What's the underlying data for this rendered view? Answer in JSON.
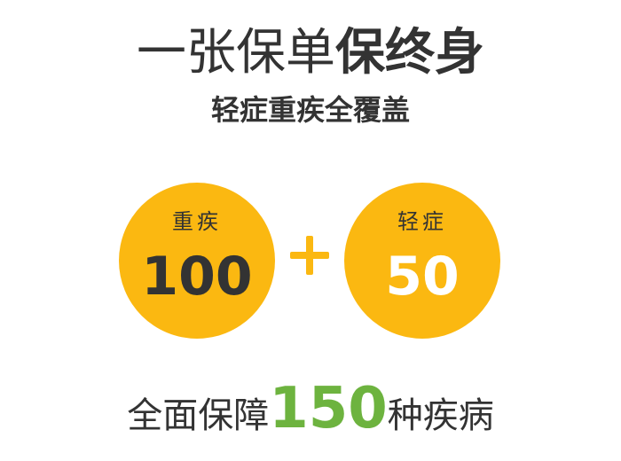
{
  "headline": {
    "light": "一张保单",
    "bold": "保终身"
  },
  "subheadline": "轻症重疾全覆盖",
  "circles": [
    {
      "label": "重疾",
      "number": "100"
    },
    {
      "label": "轻症",
      "number": "50"
    }
  ],
  "operator": "+",
  "footer": {
    "prefix": "全面保障",
    "highlight": "150",
    "suffix": "种疾病"
  },
  "colors": {
    "circle": "#FBB811",
    "highlight": "#6DB33F",
    "text": "#333333"
  }
}
